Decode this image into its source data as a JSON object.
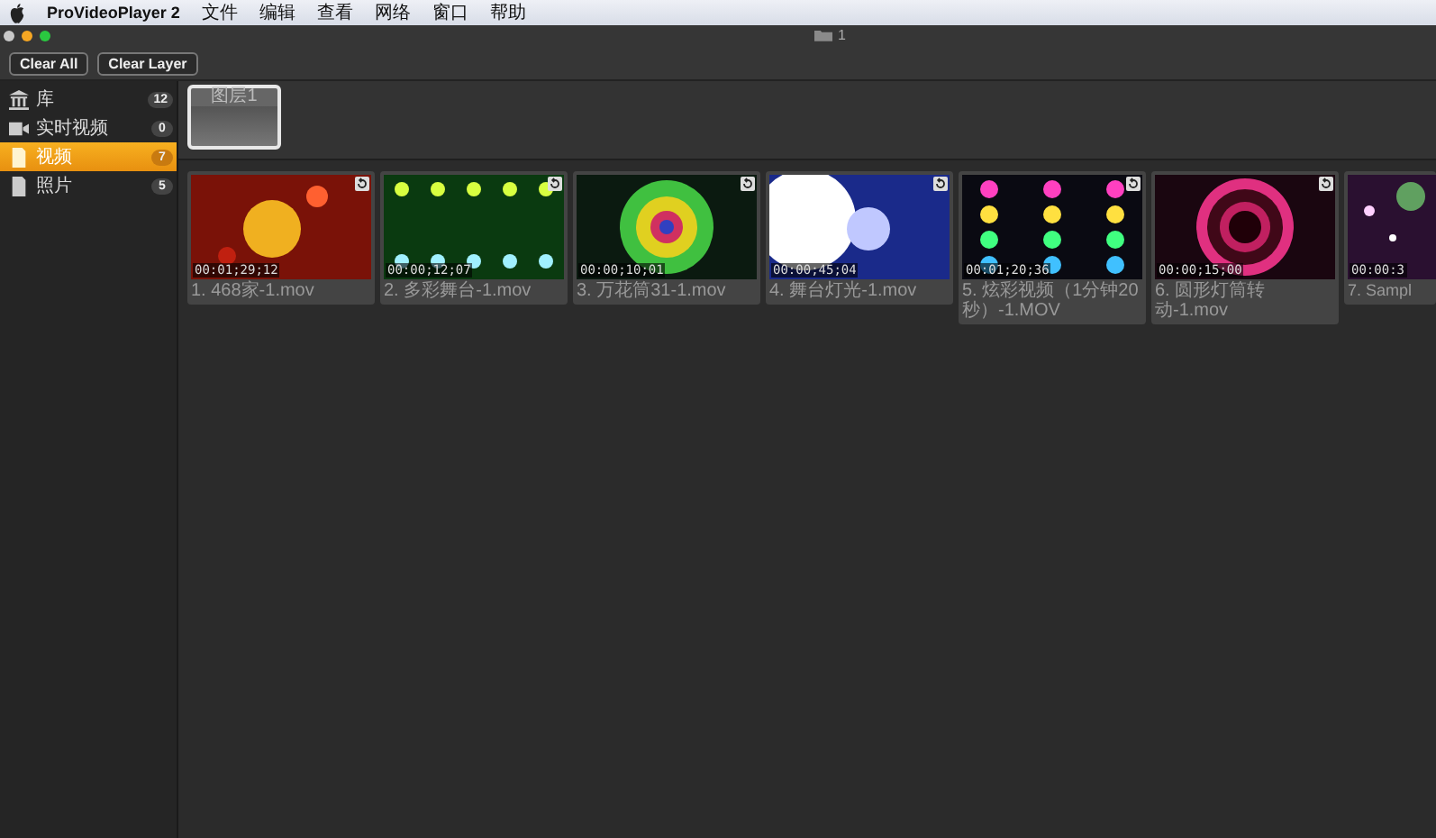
{
  "menu_bar": {
    "app": "ProVideoPlayer 2",
    "items": [
      "文件",
      "编辑",
      "查看",
      "网络",
      "窗口",
      "帮助"
    ]
  },
  "window": {
    "title": "1"
  },
  "toolbar": {
    "buttons": [
      "Clear All",
      "Clear Layer"
    ]
  },
  "sidebar": {
    "items": [
      {
        "label": "库",
        "count": "12",
        "selected": false,
        "kind": "library"
      },
      {
        "label": "实时视频",
        "count": "0",
        "selected": false,
        "kind": "live"
      },
      {
        "label": "视频",
        "count": "7",
        "selected": true,
        "kind": "file"
      },
      {
        "label": "照片",
        "count": "5",
        "selected": false,
        "kind": "file"
      }
    ]
  },
  "layers": [
    {
      "label": "图层1",
      "selected": true
    }
  ],
  "clips": [
    {
      "time": "00:01;29;12",
      "name": "1. 468家-1.mov"
    },
    {
      "time": "00:00;12;07",
      "name": "2. 多彩舞台-1.mov"
    },
    {
      "time": "00:00;10;01",
      "name": "3. 万花筒31-1.mov"
    },
    {
      "time": "00:00;45;04",
      "name": "4. 舞台灯光-1.mov"
    },
    {
      "time": "00:01;20;36",
      "name": "5. 炫彩视频（1分钟20秒）-1.MOV"
    },
    {
      "time": "00:00;15;00",
      "name": "6. 圆形灯筒转动-1.mov"
    },
    {
      "time": "00:00:3",
      "name": "7. Sampl"
    }
  ]
}
